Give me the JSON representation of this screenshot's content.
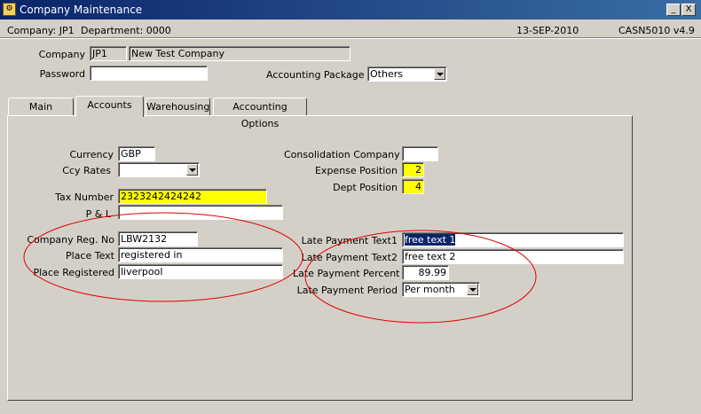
{
  "window": {
    "title": "Company Maintenance",
    "minimize": "_",
    "close": "X"
  },
  "info": {
    "company": "Company:  JP1",
    "department": "Department:  0000",
    "date": "13-SEP-2010",
    "module": "CASN5010  v4.9"
  },
  "header": {
    "company_label": "Company",
    "company_code": "JP1",
    "company_name": "New Test Company",
    "password_label": "Password",
    "password_value": "",
    "accounting_package_label": "Accounting Package",
    "accounting_package_value": "Others"
  },
  "tabs": [
    {
      "label": "Main"
    },
    {
      "label": "Accounts"
    },
    {
      "label": "Warehousing"
    },
    {
      "label": "Accounting Options"
    }
  ],
  "accounts": {
    "currency_label": "Currency",
    "currency_value": "GBP",
    "ccy_rates_label": "Ccy Rates",
    "ccy_rates_value": "",
    "tax_number_label": "Tax Number",
    "tax_number_value": "2323242424242",
    "pl_label": "P & L",
    "pl_value": "",
    "consolidation_label": "Consolidation Company",
    "consolidation_value": "",
    "expense_position_label": "Expense Position",
    "expense_position_value": "2",
    "dept_position_label": "Dept Position",
    "dept_position_value": "4",
    "company_reg_label": "Company Reg. No",
    "company_reg_value": "LBW2132",
    "place_text_label": "Place Text",
    "place_text_value": "registered in",
    "place_registered_label": "Place Registered",
    "place_registered_value": "liverpool",
    "late_text1_label": "Late Payment Text1",
    "late_text1_value": "free text 1",
    "late_text2_label": "Late Payment Text2",
    "late_text2_value": "free text 2",
    "late_percent_label": "Late Payment Percent",
    "late_percent_value": "89.99",
    "late_period_label": "Late Payment Period",
    "late_period_value": "Per month"
  },
  "colors": {
    "title_bar": "#0a246a",
    "highlight_field": "#ffff00",
    "annotation": "#e00000",
    "background": "#d4d0c8"
  }
}
